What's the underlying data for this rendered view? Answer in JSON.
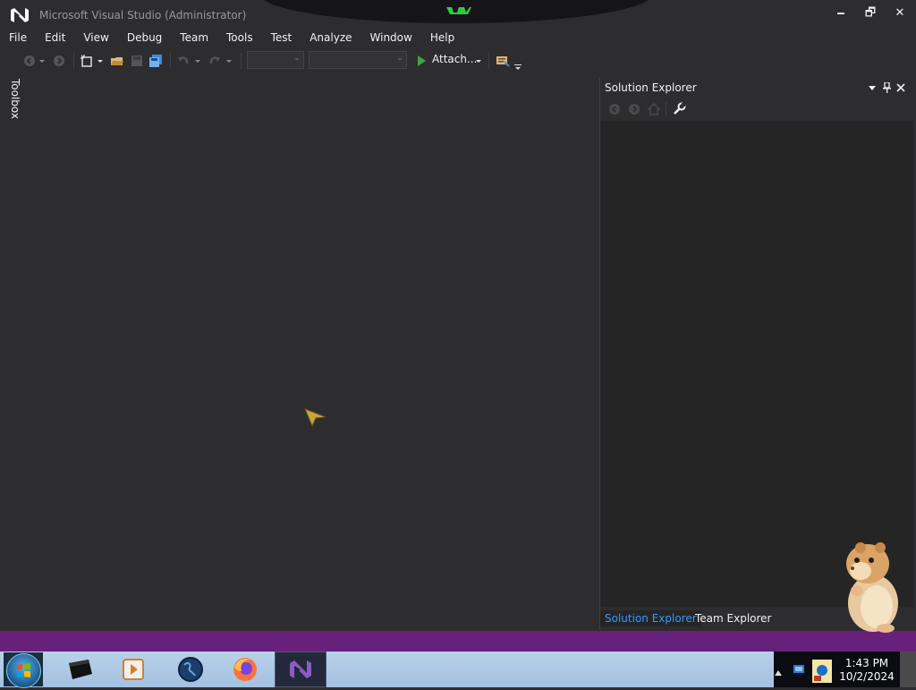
{
  "window": {
    "title": "Microsoft Visual Studio (Administrator)",
    "controls": {
      "minimize": "🗕",
      "maximize": "🗗",
      "close": "✕"
    }
  },
  "menu": [
    {
      "label": "File"
    },
    {
      "label": "Edit"
    },
    {
      "label": "View"
    },
    {
      "label": "Debug"
    },
    {
      "label": "Team"
    },
    {
      "label": "Tools"
    },
    {
      "label": "Test"
    },
    {
      "label": "Analyze"
    },
    {
      "label": "Window"
    },
    {
      "label": "Help"
    }
  ],
  "toolbar": {
    "attach_label": "Attach...",
    "icons": [
      "back-icon",
      "forward-icon",
      "new-project-icon",
      "open-file-icon",
      "save-icon",
      "save-all-icon",
      "undo-icon",
      "redo-icon",
      "start-debug-icon",
      "find-in-files-icon"
    ]
  },
  "toolbox": {
    "label": "Toolbox"
  },
  "solution_explorer": {
    "title": "Solution Explorer",
    "tabs": [
      {
        "label": "Solution Explorer",
        "active": true
      },
      {
        "label": "Team Explorer",
        "active": false
      }
    ],
    "header_icons": [
      "dropdown-icon",
      "pin-icon",
      "close-icon"
    ],
    "toolbar_icons": [
      "back-icon",
      "forward-icon",
      "home-icon",
      "properties-wrench-icon"
    ]
  },
  "taskbar": {
    "apps": [
      "terminal-icon",
      "media-player-icon",
      "globe-icon",
      "firefox-icon",
      "visual-studio-icon"
    ],
    "active_app": "visual-studio-icon",
    "clock": {
      "time": "1:43 PM",
      "date": "10/2/2024"
    }
  },
  "colors": {
    "background": "#2d2d30",
    "panel": "#252526",
    "accent_blue": "#3399ff",
    "status_bar": "#68217a",
    "vs_purple": "#68217a"
  }
}
